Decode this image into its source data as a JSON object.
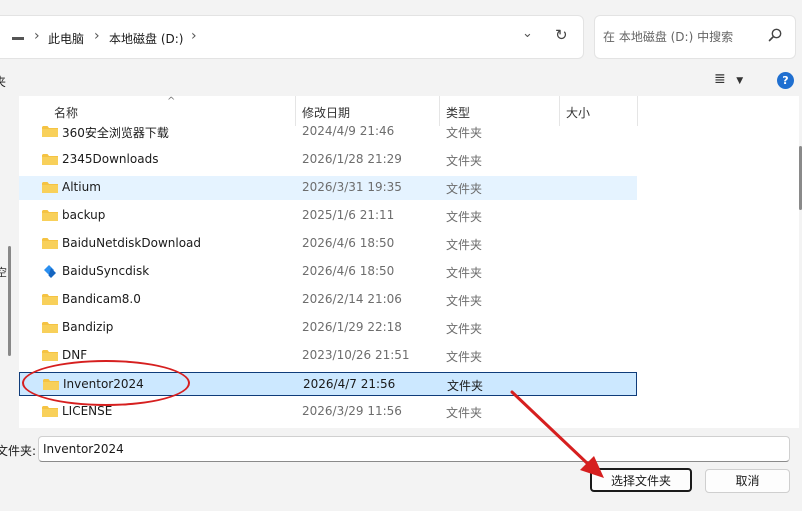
{
  "breadcrumb": {
    "items": [
      "此电脑",
      "本地磁盘 (D:)"
    ]
  },
  "search": {
    "placeholder": "在 本地磁盘 (D:) 中搜索"
  },
  "toolbar": {
    "left_fragment": "夹",
    "view_icon": "list-view-icon",
    "help_icon": "help-icon",
    "help_label": "?"
  },
  "nav": {
    "fragment": "空"
  },
  "columns": [
    "名称",
    "修改日期",
    "类型",
    "大小"
  ],
  "files": [
    {
      "name": "360安全浏览器下载",
      "date": "2024/4/9 21:46",
      "type": "文件夹",
      "icon": "folder-icon"
    },
    {
      "name": "2345Downloads",
      "date": "2026/1/28 21:29",
      "type": "文件夹",
      "icon": "folder-icon"
    },
    {
      "name": "Altium",
      "date": "2026/3/31 19:35",
      "type": "文件夹",
      "icon": "folder-icon"
    },
    {
      "name": "backup",
      "date": "2025/1/6 21:11",
      "type": "文件夹",
      "icon": "folder-icon"
    },
    {
      "name": "BaiduNetdiskDownload",
      "date": "2026/4/6 18:50",
      "type": "文件夹",
      "icon": "folder-icon"
    },
    {
      "name": "BaiduSyncdisk",
      "date": "2026/4/6 18:50",
      "type": "文件夹",
      "icon": "baidu-sync-icon"
    },
    {
      "name": "Bandicam8.0",
      "date": "2026/2/14 21:06",
      "type": "文件夹",
      "icon": "folder-icon"
    },
    {
      "name": "Bandizip",
      "date": "2026/1/29 22:18",
      "type": "文件夹",
      "icon": "folder-icon"
    },
    {
      "name": "DNF",
      "date": "2023/10/26 21:51",
      "type": "文件夹",
      "icon": "folder-icon"
    },
    {
      "name": "Inventor2024",
      "date": "2026/4/7 21:56",
      "type": "文件夹",
      "icon": "folder-icon"
    },
    {
      "name": "LICENSE",
      "date": "2026/3/29 11:56",
      "type": "文件夹",
      "icon": "folder-icon"
    }
  ],
  "bottom": {
    "folder_label": "文件夹:",
    "folder_value": "Inventor2024",
    "select_button": "选择文件夹",
    "cancel_button": "取消"
  },
  "colors": {
    "selection": "#cce8ff",
    "hover": "#e5f3ff",
    "folder": "#f5c343",
    "annotation": "#d61f1f",
    "help": "#1f6fd0"
  }
}
